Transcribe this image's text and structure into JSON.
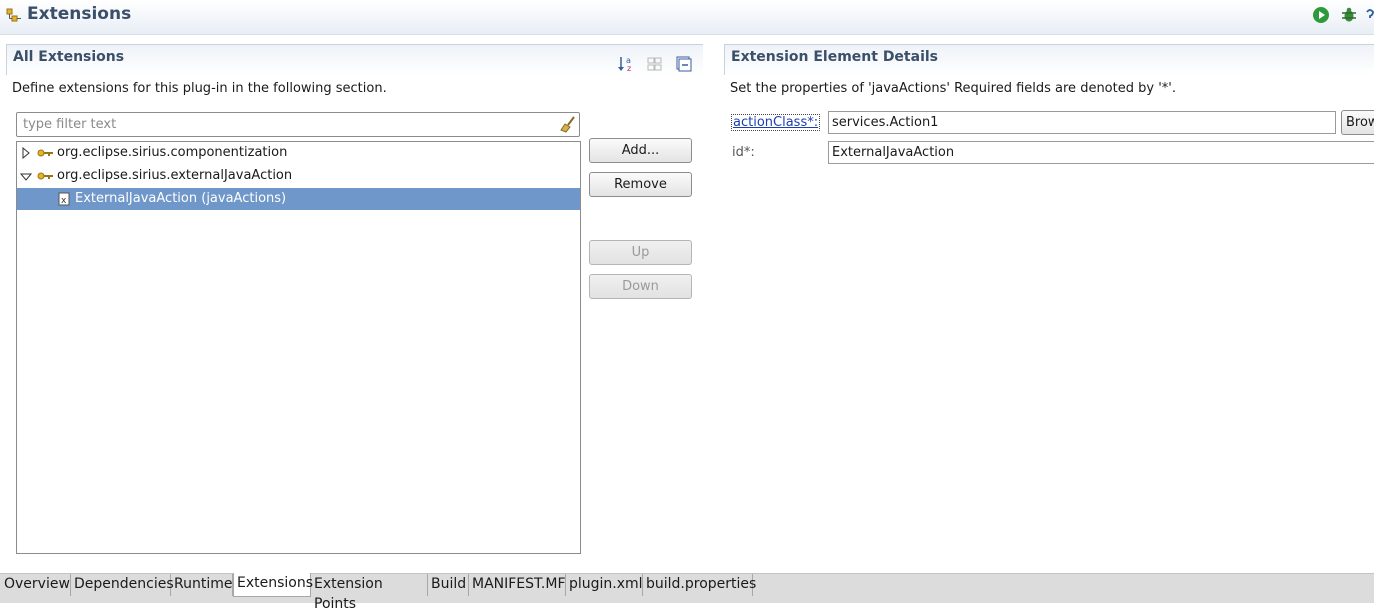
{
  "header": {
    "title": "Extensions",
    "icons": [
      "extensions-icon",
      "run-icon",
      "debug-icon",
      "help-icon"
    ],
    "colors": {
      "run": "#2e9a3b",
      "debug": "#3a8a3a"
    }
  },
  "left_section": {
    "title": "All Extensions",
    "description": "Define extensions for this plug-in in the following section.",
    "toolbar_icons": [
      "sort-alphabetically-icon",
      "show-details-icon",
      "collapse-all-icon"
    ],
    "filter_placeholder": "type filter text",
    "tree": [
      {
        "label": "org.eclipse.sirius.componentization",
        "expanded": false,
        "level": 0
      },
      {
        "label": "org.eclipse.sirius.externalJavaAction",
        "expanded": true,
        "level": 0
      },
      {
        "label": "ExternalJavaAction (javaActions)",
        "selected": true,
        "level": 1
      }
    ],
    "buttons": {
      "add": "Add...",
      "remove": "Remove",
      "up": "Up",
      "down": "Down"
    }
  },
  "right_section": {
    "title": "Extension Element Details",
    "description": "Set the properties of 'javaActions' Required fields are denoted by '*'.",
    "fields": {
      "action_class_label": "actionClass*:",
      "action_class_value": "services.Action1",
      "browse_label": "Browse...",
      "id_label": "id*:",
      "id_value": "ExternalJavaAction"
    }
  },
  "tabs": [
    {
      "label": "Overview",
      "active": false
    },
    {
      "label": "Dependencies",
      "active": false
    },
    {
      "label": "Runtime",
      "active": false
    },
    {
      "label": "Extensions",
      "active": true
    },
    {
      "label": "Extension Points",
      "active": false
    },
    {
      "label": "Build",
      "active": false
    },
    {
      "label": "MANIFEST.MF",
      "active": false
    },
    {
      "label": "plugin.xml",
      "active": false
    },
    {
      "label": "build.properties",
      "active": false
    }
  ],
  "accent_colors": {
    "selection": "#6f97c9",
    "section_title": "#3a4f6a",
    "link": "#1b3fb3"
  }
}
